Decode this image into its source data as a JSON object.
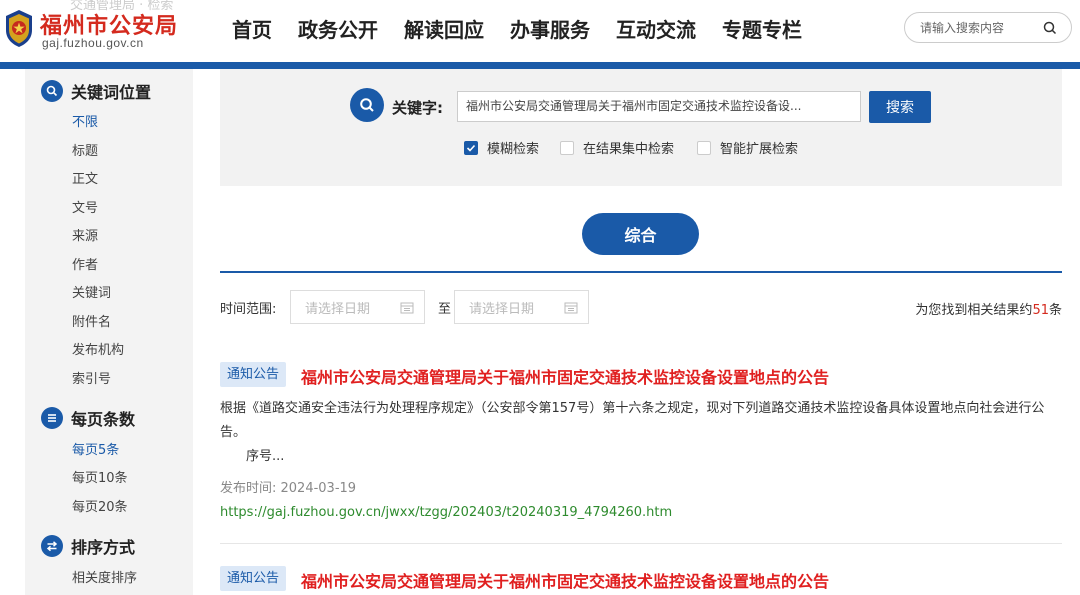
{
  "header": {
    "ghost_text": "交通管理局 · 检索",
    "site_name": "福州市公安局",
    "site_domain": "gaj.fuzhou.gov.cn",
    "nav": [
      "首页",
      "政务公开",
      "解读回应",
      "办事服务",
      "互动交流",
      "专题专栏"
    ],
    "search_placeholder": "请输入搜索内容"
  },
  "sidebar": {
    "keyword_position": {
      "title": "关键词位置",
      "items": [
        "不限",
        "标题",
        "正文",
        "文号",
        "来源",
        "作者",
        "关键词",
        "附件名",
        "发布机构",
        "索引号"
      ],
      "selected": "不限"
    },
    "page_size": {
      "title": "每页条数",
      "items": [
        "每页5条",
        "每页10条",
        "每页20条"
      ],
      "selected": "每页5条"
    },
    "sort": {
      "title": "排序方式",
      "items": [
        "相关度排序"
      ]
    }
  },
  "search": {
    "label": "关键字:",
    "value": "福州市公安局交通管理局关于福州市固定交通技术监控设备设...",
    "button": "搜索",
    "options": [
      {
        "label": "模糊检索",
        "checked": true
      },
      {
        "label": "在结果集中检索",
        "checked": false
      },
      {
        "label": "智能扩展检索",
        "checked": false
      }
    ]
  },
  "tab": "综合",
  "filter": {
    "time_label": "时间范围:",
    "from_placeholder": "请选择日期",
    "to_label": "至",
    "to_placeholder": "请选择日期",
    "count_prefix": "为您找到相关结果约",
    "count": "51",
    "count_suffix": "条"
  },
  "results": [
    {
      "badge": "通知公告",
      "title": "福州市公安局交通管理局关于福州市固定交通技术监控设备设置地点的公告",
      "summary": "根据《道路交通安全违法行为处理程序规定》（公安部令第157号）第十六条之规定，现对下列道路交通技术监控设备具体设置地点向社会进行公告。",
      "summary_tail": "序号...",
      "date": "发布时间: 2024-03-19",
      "url": "https://gaj.fuzhou.gov.cn/jwxx/tzgg/202403/t20240319_4794260.htm"
    },
    {
      "badge": "通知公告",
      "title": "福州市公安局交通管理局关于福州市固定交通技术监控设备设置地点的公告"
    }
  ],
  "colors": {
    "primary": "#1a5aa8",
    "title_red": "#e02020",
    "url_green": "#2e8b2e",
    "brand_red": "#d42a1e"
  }
}
